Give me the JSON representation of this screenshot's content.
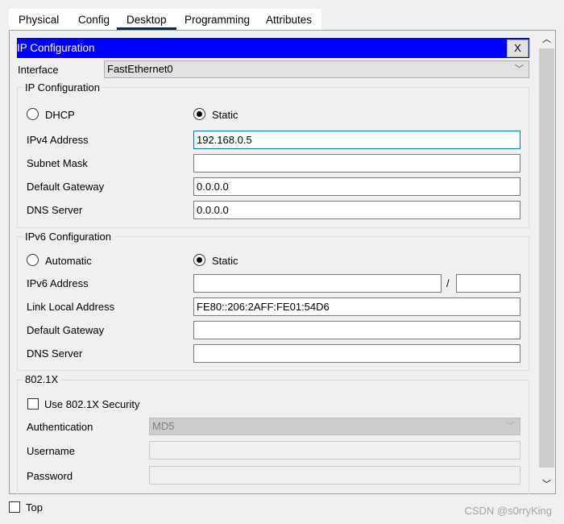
{
  "tabs": [
    "Physical",
    "Config",
    "Desktop",
    "Programming",
    "Attributes"
  ],
  "active_tab": "Desktop",
  "window": {
    "title": "IP Configuration",
    "close_label": "X",
    "title_color": "#0000ff"
  },
  "interface": {
    "label": "Interface",
    "value": "FastEthernet0"
  },
  "ipv4": {
    "legend": "IP Configuration",
    "dhcp_label": "DHCP",
    "static_label": "Static",
    "mode": "Static",
    "fields": [
      {
        "label": "IPv4 Address",
        "value": "192.168.0.5"
      },
      {
        "label": "Subnet Mask",
        "value": ""
      },
      {
        "label": "Default Gateway",
        "value": "0.0.0.0"
      },
      {
        "label": "DNS Server",
        "value": "0.0.0.0"
      }
    ]
  },
  "ipv6": {
    "legend": "IPv6 Configuration",
    "auto_label": "Automatic",
    "static_label": "Static",
    "mode": "Static",
    "slash": "/",
    "address_label": "IPv6 Address",
    "address": "",
    "prefix": "",
    "fields": [
      {
        "label": "Link Local Address",
        "value": "FE80::206:2AFF:FE01:54D6"
      },
      {
        "label": "Default Gateway",
        "value": ""
      },
      {
        "label": "DNS Server",
        "value": ""
      }
    ]
  },
  "dot1x": {
    "legend": "802.1X",
    "use_label": "Use 802.1X Security",
    "use_checked": false,
    "auth_label": "Authentication",
    "auth_value": "MD5",
    "username_label": "Username",
    "username": "",
    "password_label": "Password",
    "password": ""
  },
  "footer": {
    "top_label": "Top",
    "top_checked": false,
    "watermark": "CSDN @s0rryKing"
  }
}
